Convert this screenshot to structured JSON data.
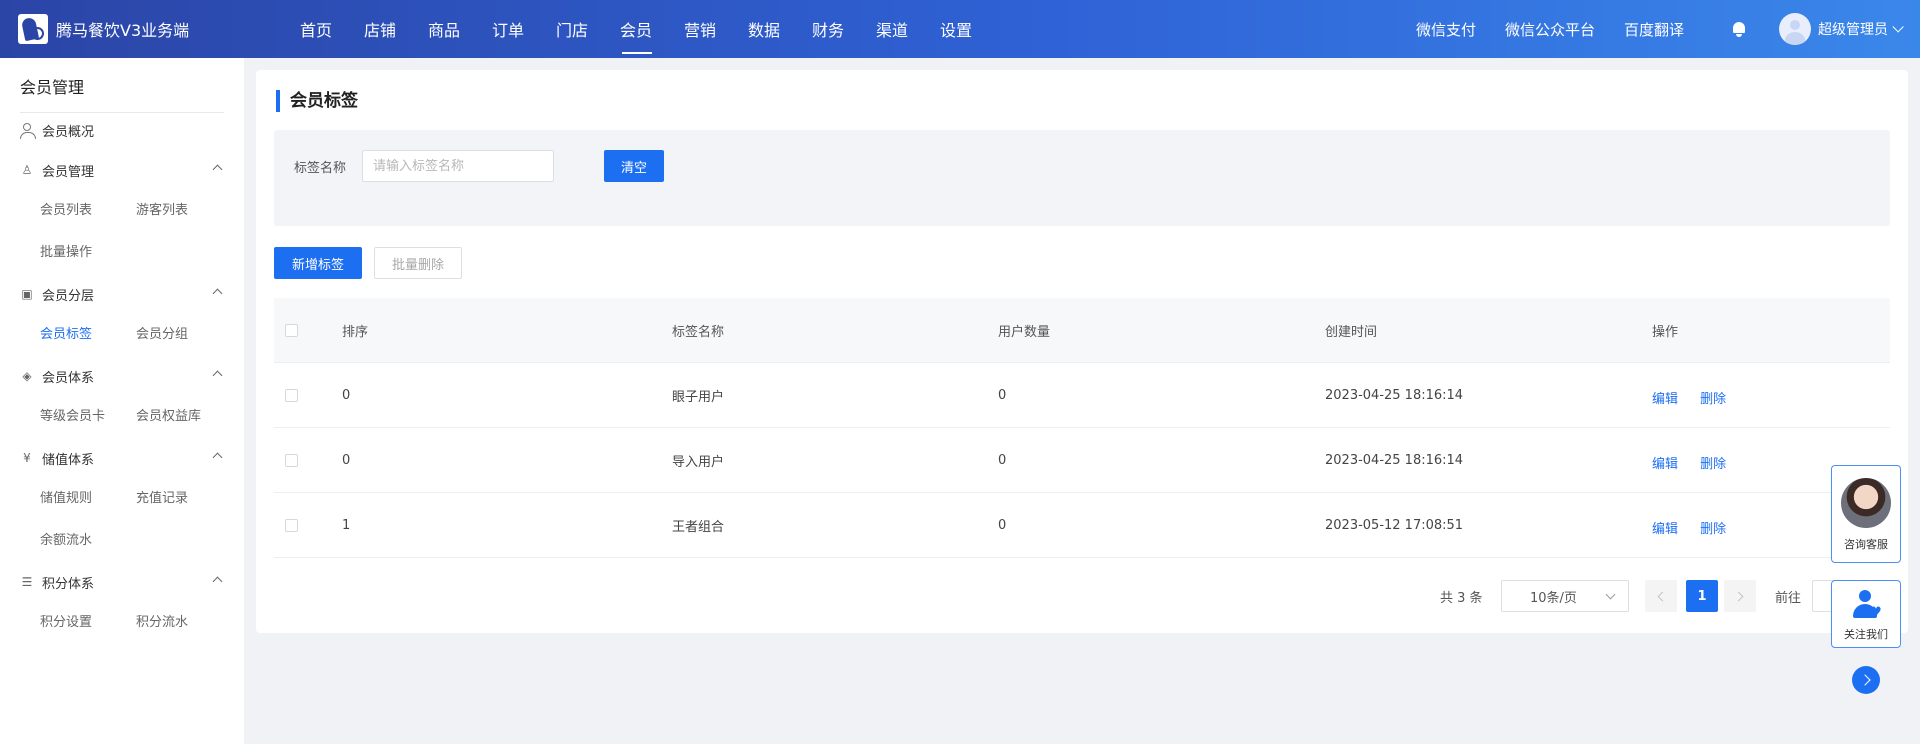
{
  "header": {
    "logo_text": "腾马餐饮V3业务端",
    "nav": [
      {
        "label": "首页",
        "active": false
      },
      {
        "label": "店铺",
        "active": false
      },
      {
        "label": "商品",
        "active": false
      },
      {
        "label": "订单",
        "active": false
      },
      {
        "label": "门店",
        "active": false
      },
      {
        "label": "会员",
        "active": true
      },
      {
        "label": "营销",
        "active": false
      },
      {
        "label": "数据",
        "active": false
      },
      {
        "label": "财务",
        "active": false
      },
      {
        "label": "渠道",
        "active": false
      },
      {
        "label": "设置",
        "active": false
      }
    ],
    "links": [
      "微信支付",
      "微信公众平台",
      "百度翻译"
    ],
    "user_name": "超级管理员"
  },
  "sidebar": {
    "title": "会员管理",
    "overview": "会员概况",
    "groups": [
      {
        "label": "会员管理",
        "icon": "users-icon",
        "items": [
          [
            "会员列表",
            "游客列表"
          ],
          [
            "批量操作"
          ]
        ]
      },
      {
        "label": "会员分层",
        "icon": "card-icon",
        "items": [
          [
            "会员标签",
            "会员分组"
          ]
        ]
      },
      {
        "label": "会员体系",
        "icon": "tag-icon",
        "items": [
          [
            "等级会员卡",
            "会员权益库"
          ]
        ]
      },
      {
        "label": "储值体系",
        "icon": "yen-icon",
        "items": [
          [
            "储值规则",
            "充值记录"
          ],
          [
            "余额流水"
          ]
        ]
      },
      {
        "label": "积分体系",
        "icon": "database-icon",
        "items": [
          [
            "积分设置",
            "积分流水"
          ]
        ]
      }
    ],
    "active_item": "会员标签"
  },
  "main": {
    "title": "会员标签",
    "filter": {
      "label": "标签名称",
      "placeholder": "请输入标签名称",
      "value": "",
      "clear_label": "清空"
    },
    "add_label": "新增标签",
    "batch_delete_label": "批量删除",
    "table": {
      "headers": [
        "排序",
        "标签名称",
        "用户数量",
        "创建时间",
        "操作"
      ],
      "rows": [
        {
          "sort": "0",
          "name": "眼子用户",
          "count": "0",
          "time": "2023-04-25 18:16:14"
        },
        {
          "sort": "0",
          "name": "导入用户",
          "count": "0",
          "time": "2023-04-25 18:16:14"
        },
        {
          "sort": "1",
          "name": "王者组合",
          "count": "0",
          "time": "2023-05-12 17:08:51"
        }
      ],
      "op_edit": "编辑",
      "op_delete": "删除"
    },
    "pagination": {
      "total": "共 3 条",
      "page_size": "10条/页",
      "current_page": "1",
      "goto_label": "前往"
    }
  },
  "floats": {
    "customer_service": "咨询客服",
    "follow_us": "关注我们"
  },
  "colors": {
    "primary": "#1d6ff2",
    "header_start": "#2b45a6",
    "header_end": "#3a87ea"
  }
}
